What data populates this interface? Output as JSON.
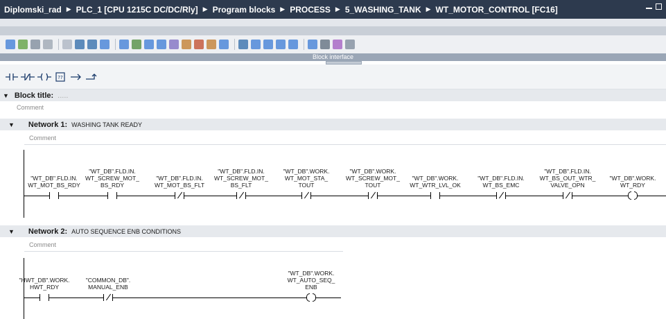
{
  "breadcrumb": [
    "Diplomski_rad",
    "PLC_1 [CPU 1215C DC/DC/Rly]",
    "Program blocks",
    "PROCESS",
    "5_WASHING_TANK",
    "WT_MOTOR_CONTROL [FC16]"
  ],
  "iface_label": "Block interface",
  "block": {
    "title_label": "Block title:",
    "title_value": ".....",
    "comment": "Comment"
  },
  "networks": [
    {
      "label": "Network 1:",
      "title": "WASHING TANK READY",
      "comment": "Comment",
      "elements": [
        {
          "kind": "NO",
          "operand": "\"WT_DB\".FLD.IN.\nWT_MOT_BS_RDY"
        },
        {
          "kind": "NO",
          "operand": "\"WT_DB\".FLD.IN.\nWT_SCREW_MOT_\nBS_RDY"
        },
        {
          "kind": "NC",
          "operand": "\"WT_DB\".FLD.IN.\nWT_MOT_BS_FLT"
        },
        {
          "kind": "NC",
          "operand": "\"WT_DB\".FLD.IN.\nWT_SCREW_MOT_\nBS_FLT"
        },
        {
          "kind": "NC",
          "operand": "\"WT_DB\".WORK.\nWT_MOT_STA_\nTOUT"
        },
        {
          "kind": "NC",
          "operand": "\"WT_DB\".WORK.\nWT_SCREW_MOT_\nTOUT"
        },
        {
          "kind": "NO",
          "operand": "\"WT_DB\".WORK.\nWT_WTR_LVL_OK"
        },
        {
          "kind": "NC",
          "operand": "\"WT_DB\".FLD.IN.\nWT_BS_EMC"
        },
        {
          "kind": "NC",
          "operand": "\"WT_DB\".FLD.IN.\nWT_BS_OUT_WTR_\nVALVE_OPN"
        },
        {
          "kind": "COIL",
          "operand": "\"WT_DB\".WORK.\nWT_RDY"
        }
      ]
    },
    {
      "label": "Network 2:",
      "title": "AUTO SEQUENCE ENB CONDITIONS",
      "comment": "Comment",
      "elements": [
        {
          "kind": "NO",
          "operand": "\"HWT_DB\".WORK.\nHWT_RDY"
        },
        {
          "kind": "NC",
          "operand": "\"COMMON_DB\".\nMANUAL_ENB"
        },
        {
          "kind": "COIL",
          "operand": "\"WT_DB\".WORK.\nWT_AUTO_SEQ_\nENB"
        }
      ]
    }
  ],
  "colors": {
    "titlebar": "#2d3a4e",
    "iface_bar": "#9aa6b6",
    "section": "#e6e9ed"
  },
  "toolbar_icons": [
    "open-icon",
    "close-icon",
    "insert-icon",
    "delete-icon",
    "network-icon",
    "expand-icon",
    "collapse-icon",
    "split-icon",
    "comment-icon",
    "abs-icon",
    "symbol-icon",
    "address-icon",
    "list-icon",
    "favorite-icon",
    "monitor-icon",
    "edge-icon",
    "run-icon",
    "stop-icon",
    "indent-icon",
    "outdent-icon",
    "insert-call-icon",
    "call-icon",
    "bookmark-icon",
    "go-icon",
    "next-icon",
    "compare-icon"
  ],
  "ladder_tools": [
    "no-contact-icon",
    "nc-contact-icon",
    "coil-icon",
    "empty-box-icon",
    "open-branch-icon",
    "close-branch-icon"
  ]
}
